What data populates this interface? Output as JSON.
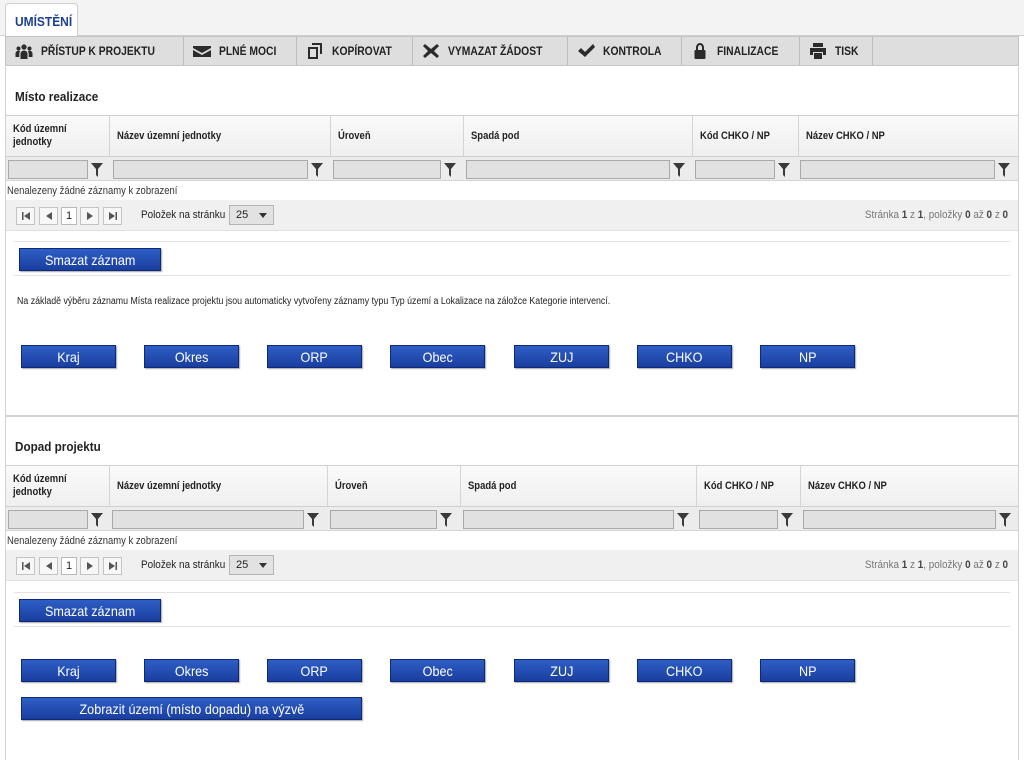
{
  "tabs": {
    "active_label": "UMÍSTĚNÍ"
  },
  "toolbar": {
    "items": [
      {
        "label": "PŘÍSTUP K PROJEKTU",
        "icon": "people-icon"
      },
      {
        "label": "PLNÉ MOCI",
        "icon": "envelope-icon"
      },
      {
        "label": "KOPÍROVAT",
        "icon": "copy-icon"
      },
      {
        "label": "VYMAZAT ŽÁDOST",
        "icon": "x-icon"
      },
      {
        "label": "KONTROLA",
        "icon": "check-icon"
      },
      {
        "label": "FINALIZACE",
        "icon": "lock-icon"
      },
      {
        "label": "TISK",
        "icon": "printer-icon"
      }
    ]
  },
  "misto": {
    "title": "Místo realizace",
    "columns": [
      "Kód územní jednotky",
      "Název územní jednotky",
      "Úroveň",
      "Spadá pod",
      "Kód CHKO / NP",
      "Název CHKO / NP"
    ],
    "empty_text": "Nenalezeny žádné záznamy k zobrazení",
    "pager": {
      "page": "1",
      "per_page_label": "Položek na stránku",
      "per_page": "25",
      "info_prefix": "Stránka ",
      "page_cur": "1",
      "info_of": " z ",
      "page_total": "1",
      "info_items": ", položky ",
      "item_from": "0",
      "info_to": " až ",
      "item_to": "0",
      "item_total": "0"
    },
    "delete_button": "Smazat záznam",
    "note": "Na základě výběru záznamu Místa realizace projektu jsou automaticky vytvořeny záznamy typu Typ území a Lokalizace na záložce Kategorie intervencí.",
    "buttons": [
      "Kraj",
      "Okres",
      "ORP",
      "Obec",
      "ZUJ",
      "CHKO",
      "NP"
    ]
  },
  "dopad": {
    "title": "Dopad projektu",
    "columns": [
      "Kód územní jednotky",
      "Název územní jednotky",
      "Úroveň",
      "Spadá pod",
      "Kód CHKO / NP",
      "Název CHKO / NP"
    ],
    "empty_text": "Nenalezeny žádné záznamy k zobrazení",
    "pager": {
      "page": "1",
      "per_page_label": "Položek na stránku",
      "per_page": "25",
      "info_prefix": "Stránka ",
      "page_cur": "1",
      "info_of": " z ",
      "page_total": "1",
      "info_items": ", položky ",
      "item_from": "0",
      "info_to": " až ",
      "item_to": "0",
      "item_total": "0"
    },
    "delete_button": "Smazat záznam",
    "buttons": [
      "Kraj",
      "Okres",
      "ORP",
      "Obec",
      "ZUJ",
      "CHKO",
      "NP"
    ],
    "show_button": "Zobrazit území (místo dopadu) na výzvě"
  },
  "colors": {
    "accent": "#1c3f94",
    "button": "#2451b3"
  }
}
